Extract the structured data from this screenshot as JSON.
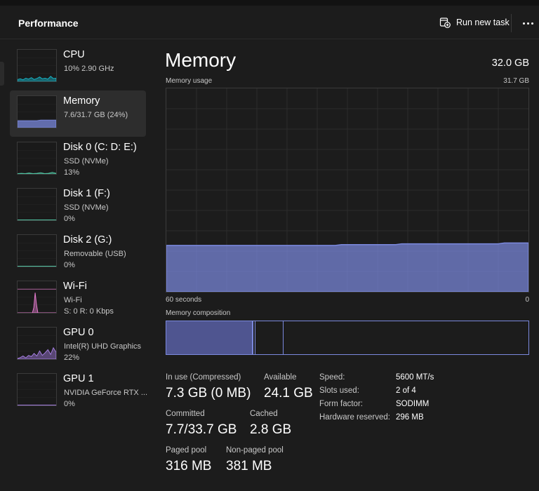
{
  "header": {
    "title": "Performance",
    "run_task_label": "Run new task",
    "run_task_icon": "run-task-icon",
    "more_icon": "more-icon"
  },
  "sidebar": {
    "items": [
      {
        "title": "CPU",
        "lines": [
          "10%  2.90 GHz"
        ],
        "color": "#17b5c7",
        "selected": false,
        "level": 0.1
      },
      {
        "title": "Memory",
        "lines": [
          "7.6/31.7 GB (24%)"
        ],
        "color": "#7b89de",
        "selected": true,
        "level": 0.24
      },
      {
        "title": "Disk 0 (C: D: E:)",
        "lines": [
          "SSD (NVMe)",
          "13%"
        ],
        "color": "#4fc1a0",
        "selected": false,
        "level": 0.13
      },
      {
        "title": "Disk 1 (F:)",
        "lines": [
          "SSD (NVMe)",
          "0%"
        ],
        "color": "#4fc1a0",
        "selected": false,
        "level": 0.0
      },
      {
        "title": "Disk 2 (G:)",
        "lines": [
          "Removable (USB)",
          "0%"
        ],
        "color": "#4fc1a0",
        "selected": false,
        "level": 0.0
      },
      {
        "title": "Wi-Fi",
        "lines": [
          "Wi-Fi",
          "S: 0 R: 0 Kbps"
        ],
        "color": "#e77dd0",
        "selected": false,
        "level": 0.0
      },
      {
        "title": "GPU 0",
        "lines": [
          "Intel(R) UHD Graphics",
          "22%"
        ],
        "color": "#a47de0",
        "selected": false,
        "level": 0.22
      },
      {
        "title": "GPU 1",
        "lines": [
          "NVIDIA GeForce RTX ...",
          "0%"
        ],
        "color": "#a47de0",
        "selected": false,
        "level": 0.0
      }
    ]
  },
  "main": {
    "title": "Memory",
    "total": "32.0 GB",
    "usage_label": "Memory usage",
    "usage_max": "31.7 GB",
    "time_left": "60 seconds",
    "time_right": "0",
    "composition_label": "Memory composition",
    "graph_color": "#7b89de",
    "usage_fraction": 0.24
  },
  "stats": {
    "in_use_label": "In use (Compressed)",
    "in_use_value": "7.3 GB (0 MB)",
    "available_label": "Available",
    "available_value": "24.1 GB",
    "committed_label": "Committed",
    "committed_value": "7.7/33.7 GB",
    "cached_label": "Cached",
    "cached_value": "2.8 GB",
    "paged_label": "Paged pool",
    "paged_value": "316 MB",
    "nonpaged_label": "Non-paged pool",
    "nonpaged_value": "381 MB"
  },
  "specs": [
    {
      "label": "Speed:",
      "value": "5600 MT/s"
    },
    {
      "label": "Slots used:",
      "value": "2 of 4"
    },
    {
      "label": "Form factor:",
      "value": "SODIMM"
    },
    {
      "label": "Hardware reserved:",
      "value": "296 MB"
    }
  ]
}
